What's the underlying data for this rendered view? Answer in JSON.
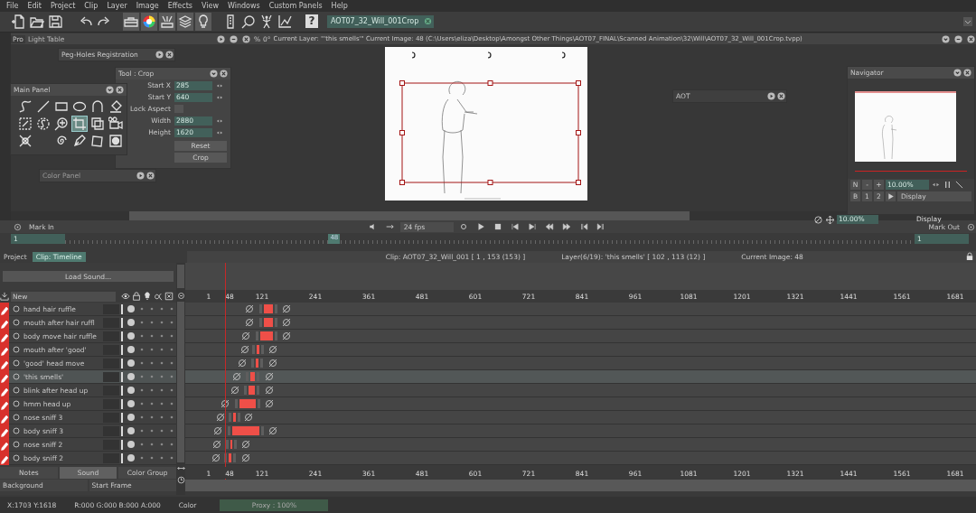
{
  "menu": [
    "File",
    "Edit",
    "Project",
    "Clip",
    "Layer",
    "Image",
    "Effects",
    "View",
    "Windows",
    "Custom Panels",
    "Help"
  ],
  "toolbar": {
    "help": "?",
    "project_field": "AOT07_32_Will_001Crop"
  },
  "light_table": {
    "tab_cut": "Pro",
    "title": "Light Table",
    "zoom_suffix": "%",
    "angle": "0°",
    "info": "Current Layer: \"'this smells'\"  Current Image: 48 (C:\\Users\\eliza\\Desktop\\Amongst Other Things\\AOT07_FINAL\\Scanned Animation\\32\\Will\\AOT07_32_Will_001Crop.tvpp)"
  },
  "peg_holes": {
    "title": "Peg-Holes Registration"
  },
  "tool_crop": {
    "title": "Tool : Crop",
    "fields": [
      {
        "kind": "number",
        "label": "Start X",
        "value": "285"
      },
      {
        "kind": "number",
        "label": "Start Y",
        "value": "640"
      },
      {
        "kind": "checkbox",
        "label": "Lock Aspect",
        "checked": false
      },
      {
        "kind": "number",
        "label": "Width",
        "value": "2880"
      },
      {
        "kind": "number",
        "label": "Height",
        "value": "1620"
      }
    ],
    "buttons": [
      "Reset",
      "Crop"
    ]
  },
  "main_panel": {
    "title": "Main Panel",
    "tools": [
      {
        "kind": "curve",
        "selected": false
      },
      {
        "kind": "line",
        "selected": false
      },
      {
        "kind": "rect",
        "selected": false
      },
      {
        "kind": "ellipse",
        "selected": false
      },
      {
        "kind": "arc",
        "selected": false
      },
      {
        "kind": "eraser",
        "selected": false
      },
      {
        "kind": "select",
        "selected": false
      },
      {
        "kind": "magic",
        "selected": false
      },
      {
        "kind": "zoom",
        "selected": false
      },
      {
        "kind": "crop",
        "selected": true
      },
      {
        "kind": "transform",
        "selected": false
      },
      {
        "kind": "camera",
        "selected": false
      },
      {
        "kind": "warp",
        "selected": false
      },
      {
        "kind": "spiral",
        "selected": false
      },
      {
        "kind": "pen",
        "selected": false
      },
      {
        "kind": "paper",
        "selected": false
      },
      {
        "kind": "blur",
        "selected": false
      }
    ]
  },
  "color_panel": {
    "title": "Color Panel"
  },
  "aot_panel": {
    "title": "AOT"
  },
  "navigator": {
    "title": "Navigator",
    "buttons": [
      "N",
      "-",
      "+"
    ],
    "zoom": "10.00%",
    "row2": [
      "B",
      "1",
      "2"
    ],
    "display": "Display"
  },
  "view_controls": {
    "zoom": "10.00%",
    "display": "Display"
  },
  "transport": {
    "mark_in": "Mark In",
    "mark_in_value": "1",
    "fps": "24 fps",
    "current_frame": "48",
    "level": 0.31,
    "mark_out": "Mark Out",
    "mark_out_value": "1"
  },
  "timeline": {
    "tabs": [
      {
        "label": "Project",
        "selected": false
      },
      {
        "label": "Clip: Timeline",
        "selected": true
      }
    ],
    "clip_info": "Clip: AOT07_32_Will_001 [ 1 , 153  (153) ]",
    "layer_info": "Layer(6/19): 'this smells' [ 102 , 113  (12) ]",
    "current_image": "Current Image: 48",
    "load_sound": "Load Sound...",
    "new_dropdown": "New",
    "frame_ticks": [
      "1",
      "48",
      "121",
      "241",
      "361",
      "481",
      "601",
      "721",
      "841",
      "961",
      "1081",
      "1201",
      "1321",
      "1441",
      "1561",
      "1681"
    ],
    "layers": [
      {
        "name": "hand hair ruffle",
        "selected": false
      },
      {
        "name": "mouth after hair ruffl",
        "selected": false
      },
      {
        "name": "body move hair ruffle",
        "selected": false
      },
      {
        "name": "mouth after 'good'",
        "selected": false
      },
      {
        "name": "'good' head move",
        "selected": false
      },
      {
        "name": "'this smells'",
        "selected": true
      },
      {
        "name": "blink after head up",
        "selected": false
      },
      {
        "name": "hmm head up",
        "selected": false
      },
      {
        "name": "nose sniff 3",
        "selected": false
      },
      {
        "name": "body sniff 3",
        "selected": false
      },
      {
        "name": "nose sniff 2",
        "selected": false
      },
      {
        "name": "body sniff 2",
        "selected": false
      }
    ],
    "bottom_tabs": [
      {
        "label": "Notes",
        "selected": false
      },
      {
        "label": "Sound",
        "selected": true
      },
      {
        "label": "Color Group",
        "selected": false
      }
    ],
    "bottom_frame_ticks": [
      "1",
      "48",
      "121",
      "241",
      "361",
      "481",
      "601",
      "721",
      "841",
      "961",
      "1081",
      "1201",
      "1321",
      "1441",
      "1561",
      "1681"
    ],
    "background": "Background",
    "start_frame": "Start Frame"
  },
  "status_bar": {
    "coords": "X:1703  Y:1618",
    "rgba": "R:000 G:000 B:000 A:000",
    "color_label": "Color",
    "proxy": "Proxy : 100%"
  }
}
